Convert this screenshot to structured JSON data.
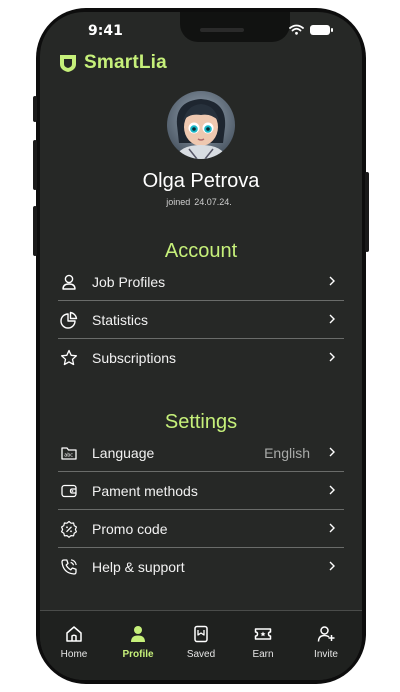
{
  "status_bar": {
    "time": "9:41"
  },
  "brand": {
    "name": "SmartLia",
    "accent": "#c6f07a"
  },
  "profile": {
    "name": "Olga Petrova",
    "joined_label": "joined",
    "joined_date": "24.07.24."
  },
  "account": {
    "title": "Account",
    "items": [
      {
        "label": "Job Profiles",
        "icon": "user-icon"
      },
      {
        "label": "Statistics",
        "icon": "pie-chart-icon"
      },
      {
        "label": "Subscriptions",
        "icon": "star-icon"
      }
    ]
  },
  "settings": {
    "title": "Settings",
    "items": [
      {
        "label": "Language",
        "value": "English",
        "icon": "language-icon"
      },
      {
        "label": "Pament methods",
        "icon": "wallet-icon"
      },
      {
        "label": "Promo code",
        "icon": "promo-badge-icon"
      },
      {
        "label": "Help & support",
        "icon": "phone-icon"
      }
    ]
  },
  "tabbar": {
    "active": "Profile",
    "tabs": [
      {
        "label": "Home",
        "icon": "home-icon"
      },
      {
        "label": "Profile",
        "icon": "profile-icon"
      },
      {
        "label": "Saved",
        "icon": "bookmark-icon"
      },
      {
        "label": "Earn",
        "icon": "ticket-icon"
      },
      {
        "label": "Invite",
        "icon": "add-user-icon"
      }
    ]
  }
}
